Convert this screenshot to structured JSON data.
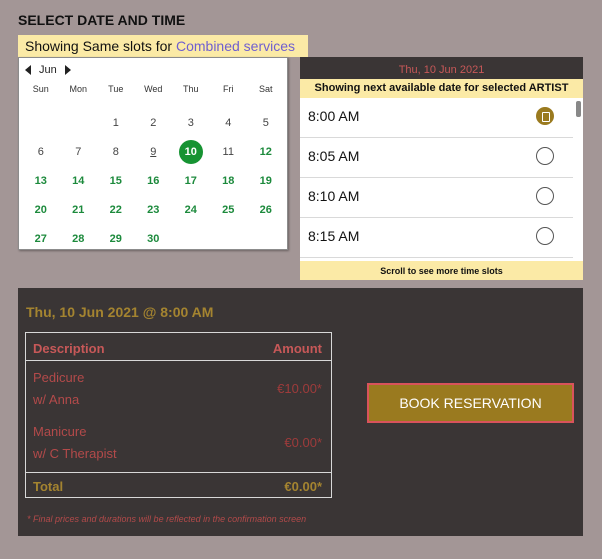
{
  "page": {
    "title": "SELECT DATE AND TIME",
    "notice_prefix": "Showing Same slots for",
    "notice_services": "Combined services"
  },
  "calendar": {
    "month": "Jun",
    "weekdays": [
      "Sun",
      "Mon",
      "Tue",
      "Wed",
      "Thu",
      "Fri",
      "Sat"
    ],
    "days": [
      {
        "n": "",
        "s": "empty"
      },
      {
        "n": "",
        "s": "empty"
      },
      {
        "n": "1",
        "s": "plain"
      },
      {
        "n": "2",
        "s": "plain"
      },
      {
        "n": "3",
        "s": "plain"
      },
      {
        "n": "4",
        "s": "plain"
      },
      {
        "n": "5",
        "s": "plain"
      },
      {
        "n": "6",
        "s": "plain"
      },
      {
        "n": "7",
        "s": "plain"
      },
      {
        "n": "8",
        "s": "plain"
      },
      {
        "n": "9",
        "s": "today"
      },
      {
        "n": "10",
        "s": "selected"
      },
      {
        "n": "11",
        "s": "plain"
      },
      {
        "n": "12",
        "s": "avail"
      },
      {
        "n": "13",
        "s": "avail"
      },
      {
        "n": "14",
        "s": "avail"
      },
      {
        "n": "15",
        "s": "avail"
      },
      {
        "n": "16",
        "s": "avail"
      },
      {
        "n": "17",
        "s": "avail"
      },
      {
        "n": "18",
        "s": "avail"
      },
      {
        "n": "19",
        "s": "avail"
      },
      {
        "n": "20",
        "s": "avail"
      },
      {
        "n": "21",
        "s": "avail"
      },
      {
        "n": "22",
        "s": "avail"
      },
      {
        "n": "23",
        "s": "avail"
      },
      {
        "n": "24",
        "s": "avail"
      },
      {
        "n": "25",
        "s": "avail"
      },
      {
        "n": "26",
        "s": "avail"
      },
      {
        "n": "27",
        "s": "avail"
      },
      {
        "n": "28",
        "s": "avail"
      },
      {
        "n": "29",
        "s": "avail"
      },
      {
        "n": "30",
        "s": "avail"
      }
    ]
  },
  "slots": {
    "date": "Thu, 10 Jun 2021",
    "message": "Showing next available date for selected ARTIST",
    "items": [
      {
        "time": "8:00 AM",
        "selected": true
      },
      {
        "time": "8:05 AM",
        "selected": false
      },
      {
        "time": "8:10 AM",
        "selected": false
      },
      {
        "time": "8:15 AM",
        "selected": false
      }
    ],
    "footer": "Scroll to see more time slots"
  },
  "summary": {
    "datetime": "Thu, 10 Jun 2021 @ 8:00 AM",
    "col_description": "Description",
    "col_amount": "Amount",
    "items": [
      {
        "line1": "Pedicure",
        "line2": "w/ Anna",
        "price": "€10.00*"
      },
      {
        "line1": "Manicure",
        "line2": "w/ C Therapist",
        "price": "€0.00*"
      }
    ],
    "total_label": "Total",
    "total_value": "€0.00*",
    "book_label": "BOOK RESERVATION",
    "footnote": "* Final prices and durations will be reflected in the confirmation screen"
  },
  "colors": {
    "background": "#a39696",
    "panel": "#3a3535",
    "highlight": "#fbeaa6",
    "accent_gold": "#9a7a1f",
    "available_green": "#1c8a3c"
  }
}
